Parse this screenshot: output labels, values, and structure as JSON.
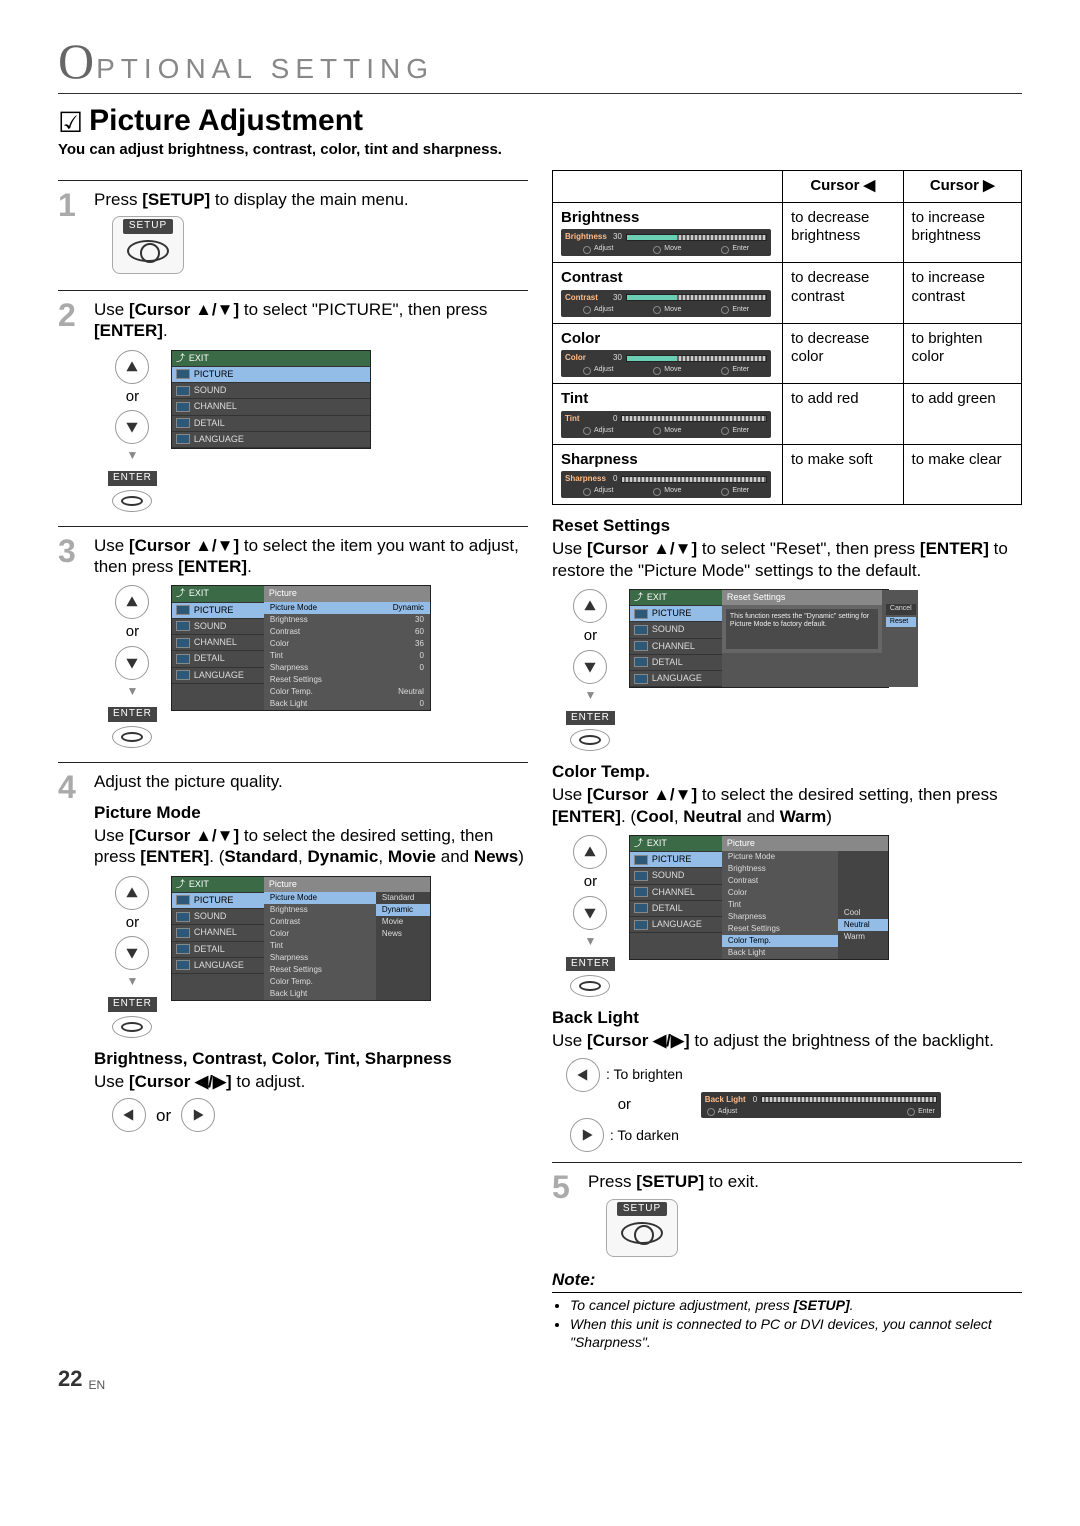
{
  "header": {
    "o": "O",
    "rest": "PTIONAL   SETTING"
  },
  "title": "Picture Adjustment",
  "subtitle": "You can adjust brightness, contrast, color, tint and sharpness.",
  "steps": {
    "s1": "Press [SETUP] to display the main menu.",
    "s2a": "Use [Cursor ▲/▼] to select \"PICTURE\", then press",
    "s2b": "[ENTER].",
    "s3a": "Use [Cursor ▲/▼] to select the item you want to adjust,",
    "s3b": "then press [ENTER].",
    "s4": "Adjust the picture quality.",
    "s5": "Press [SETUP] to exit."
  },
  "labels": {
    "setup": "SETUP",
    "enter": "ENTER",
    "or": "or",
    "adjust": "Adjust",
    "move": "Move",
    "enter_s": "Enter",
    "exit": "EXIT"
  },
  "osd_menu": [
    "PICTURE",
    "SOUND",
    "CHANNEL",
    "DETAIL",
    "LANGUAGE"
  ],
  "picture_menu": {
    "header": "Picture",
    "items": [
      {
        "k": "Picture Mode",
        "v": "Dynamic"
      },
      {
        "k": "Brightness",
        "v": "30"
      },
      {
        "k": "Contrast",
        "v": "60"
      },
      {
        "k": "Color",
        "v": "36"
      },
      {
        "k": "Tint",
        "v": "0"
      },
      {
        "k": "Sharpness",
        "v": "0"
      },
      {
        "k": "Reset Settings",
        "v": ""
      },
      {
        "k": "Color Temp.",
        "v": "Neutral"
      },
      {
        "k": "Back Light",
        "v": "0"
      }
    ]
  },
  "picture_mode": {
    "title": "Picture Mode",
    "desc1": "Use [Cursor ▲/▼] to select the desired setting, then",
    "desc2": "press [ENTER]. (Standard, Dynamic, Movie and News)",
    "options": [
      "Standard",
      "Dynamic",
      "Movie",
      "News"
    ],
    "left_items": [
      "Picture Mode",
      "Brightness",
      "Contrast",
      "Color",
      "Tint",
      "Sharpness",
      "Reset Settings",
      "Color Temp.",
      "Back Light"
    ]
  },
  "bcct": {
    "title": "Brightness, Contrast, Color, Tint, Sharpness",
    "desc": "Use [Cursor ◀/▶] to adjust."
  },
  "adjtable": {
    "h1": "Cursor ◀",
    "h2": "Cursor ▶",
    "rows": [
      {
        "label": "Brightness",
        "slider": "Brightness",
        "val": "30",
        "fill": 36,
        "left": "to decrease brightness",
        "right": "to increase brightness"
      },
      {
        "label": "Contrast",
        "slider": "Contrast",
        "val": "30",
        "fill": 36,
        "left": "to decrease contrast",
        "right": "to increase contrast"
      },
      {
        "label": "Color",
        "slider": "Color",
        "val": "30",
        "fill": 36,
        "left": "to decrease color",
        "right": "to brighten color"
      },
      {
        "label": "Tint",
        "slider": "Tint",
        "val": "0",
        "fill": 0,
        "left": "to add red",
        "right": "to add green"
      },
      {
        "label": "Sharpness",
        "slider": "Sharpness",
        "val": "0",
        "fill": 0,
        "left": "to make soft",
        "right": "to make clear"
      }
    ]
  },
  "reset": {
    "title": "Reset Settings",
    "desc1": "Use [Cursor ▲/▼] to select \"Reset\", then press [ENTER]",
    "desc2": "to restore the \"Picture Mode\" settings to the default.",
    "panel_hdr": "Reset Settings",
    "msg": "This function resets the \"Dynamic\" setting for Picture Mode to factory default.",
    "opts": [
      "Cancel",
      "Reset"
    ]
  },
  "colortemp": {
    "title": "Color Temp.",
    "desc1": "Use [Cursor ▲/▼] to select the desired setting, then",
    "desc2": "press [ENTER]. (Cool, Neutral and Warm)",
    "options": [
      "Cool",
      "Neutral",
      "Warm"
    ],
    "left_items": [
      "Picture Mode",
      "Brightness",
      "Contrast",
      "Color",
      "Tint",
      "Sharpness",
      "Reset Settings",
      "Color Temp.",
      "Back Light"
    ]
  },
  "backlight": {
    "title": "Back Light",
    "desc": "Use [Cursor ◀/▶] to adjust the brightness of the backlight.",
    "left": ": To brighten",
    "right": ": To darken",
    "bar": {
      "label": "Back Light",
      "val": "0"
    }
  },
  "note": {
    "h": "Note:",
    "items": [
      "To cancel picture adjustment, press [SETUP].",
      "When this unit is connected to PC or DVI devices, you cannot select \"Sharpness\"."
    ]
  },
  "page": {
    "num": "22",
    "lang": "EN"
  }
}
